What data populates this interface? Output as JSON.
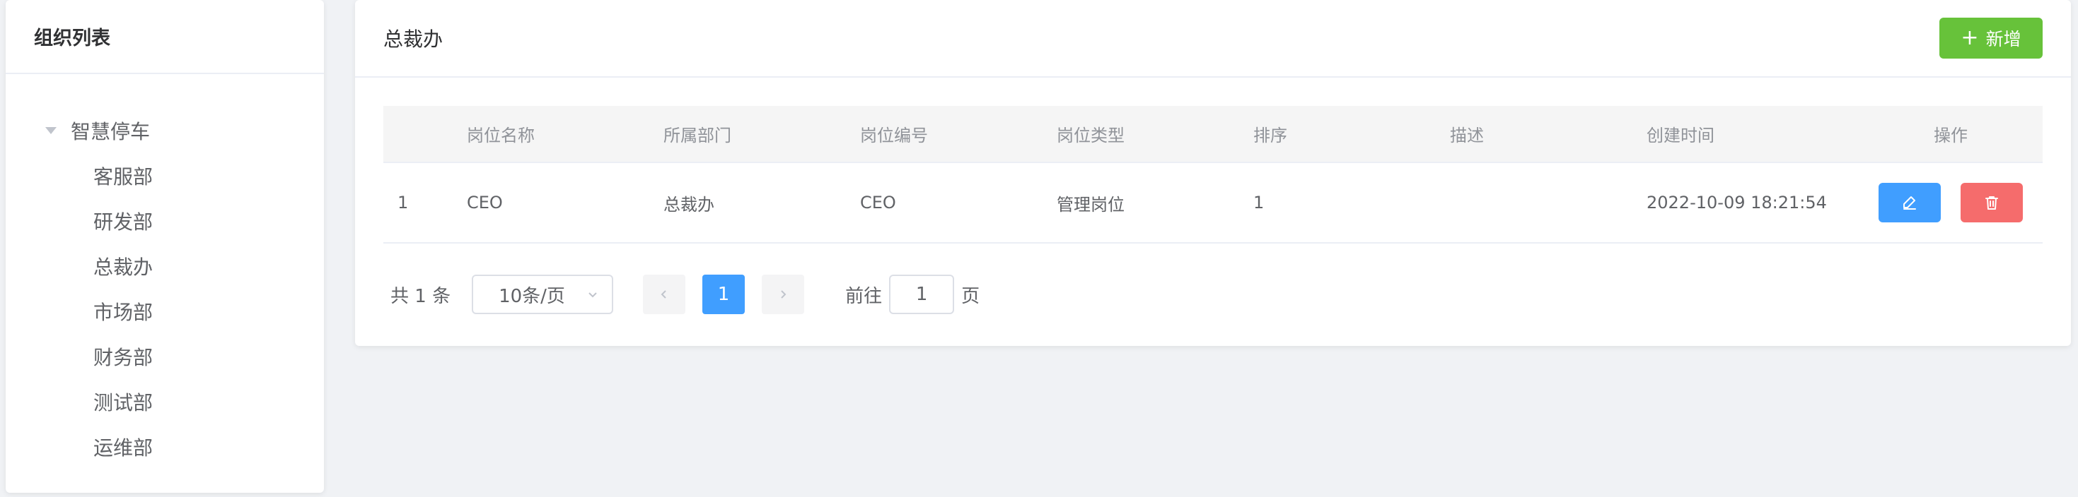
{
  "sidebar": {
    "title": "组织列表",
    "root": "智慧停车",
    "children": [
      "客服部",
      "研发部",
      "总裁办",
      "市场部",
      "财务部",
      "测试部",
      "运维部"
    ]
  },
  "main": {
    "title": "总裁办",
    "add_label": "新增"
  },
  "table": {
    "headers": [
      "",
      "岗位名称",
      "所属部门",
      "岗位编号",
      "岗位类型",
      "排序",
      "描述",
      "创建时间",
      "操作"
    ],
    "rows": [
      [
        "1",
        "CEO",
        "总裁办",
        "CEO",
        "管理岗位",
        "1",
        "",
        "2022-10-09 18:21:54"
      ]
    ]
  },
  "pagination": {
    "total_text": "共 1 条",
    "page_size": "10条/页",
    "current_page": "1",
    "goto_label": "前往",
    "goto_value": "1",
    "page_unit": "页"
  },
  "colors": {
    "primary": "#409eff",
    "success": "#67c23a",
    "danger": "#f56c6c"
  }
}
